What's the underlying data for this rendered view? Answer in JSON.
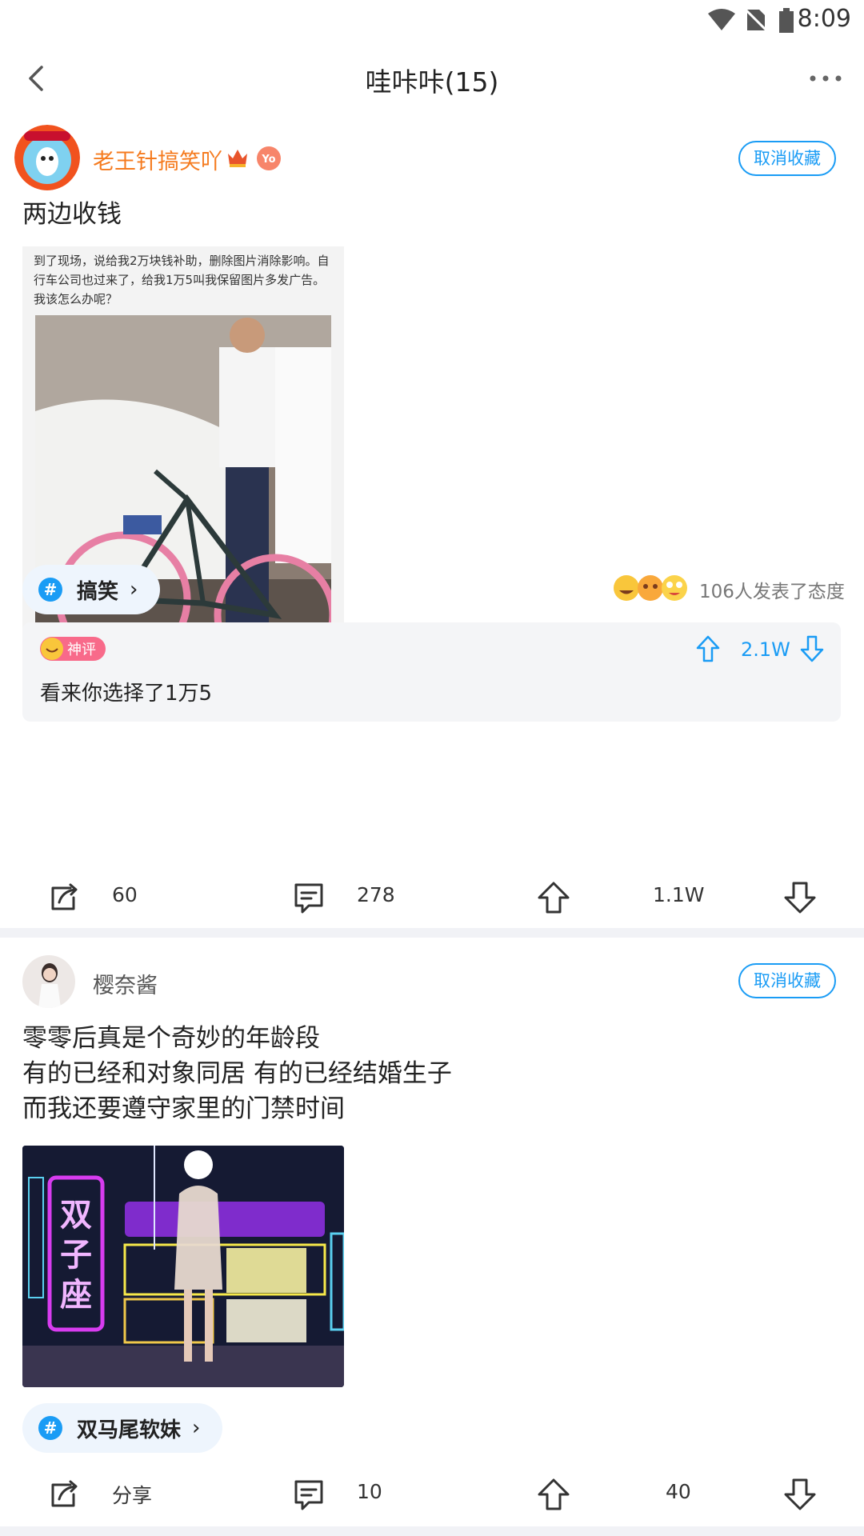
{
  "status_bar": {
    "time": "8:09"
  },
  "nav": {
    "title": "哇咔咔(15)"
  },
  "post1": {
    "username": "老王针搞笑吖",
    "follow_label": "取消收藏",
    "text": "两边收钱",
    "image": {
      "caption_text": "到了现场，说给我2万块钱补助，删除图片消除影响。自行车公司也过来了，给我1万5叫我保留图片多发广告。我该怎么办呢？"
    },
    "tag": "搞笑",
    "reactions_text": "106人发表了态度",
    "hot_comment": {
      "badge": "神评",
      "text": "看来你选择了1万5",
      "likes": "2.1W"
    },
    "actions": {
      "share": "60",
      "comments": "278",
      "likes": "1.1W"
    }
  },
  "post2": {
    "username": "樱奈酱",
    "follow_label": "取消收藏",
    "text_lines": [
      "零零后真是个奇妙的年龄段",
      "有的已经和对象同居 有的已经结婚生子",
      "而我还要遵守家里的门禁时间"
    ],
    "tag": "双马尾软妹",
    "actions": {
      "share": "分享",
      "comments": "10",
      "likes": "40"
    }
  },
  "colors": {
    "accent": "#1a9cf5",
    "username_vip": "#f57b1f",
    "tag_bg": "#eef5fd"
  }
}
